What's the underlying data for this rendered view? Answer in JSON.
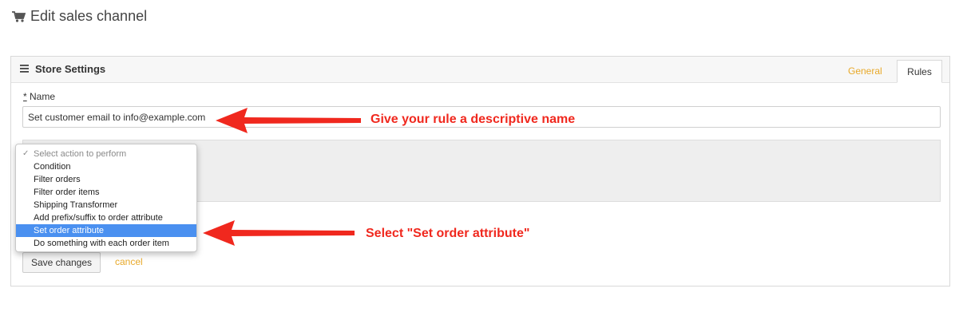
{
  "header": {
    "title": "Edit sales channel",
    "icon": "cart-icon"
  },
  "panel": {
    "title": "Store Settings",
    "tabs": [
      {
        "label": "General",
        "active": false
      },
      {
        "label": "Rules",
        "active": true
      }
    ]
  },
  "form": {
    "name_required_mark": "*",
    "name_label": "Name",
    "name_value": "Set customer email to info@example.com",
    "save_label": "Save changes",
    "cancel_label": "cancel"
  },
  "action_dropdown": {
    "items": [
      "Select action to perform",
      "Condition",
      "Filter orders",
      "Filter order items",
      "Shipping Transformer",
      "Add prefix/suffix to order attribute",
      "Set order attribute",
      "Do something with each order item"
    ],
    "checked_item": "Select action to perform",
    "highlighted_item": "Set order attribute"
  },
  "annotations": {
    "name_hint": "Give your rule a descriptive name",
    "select_hint": "Select \"Set order attribute\""
  },
  "colors": {
    "accent": "#e8a92a",
    "highlight": "#4a90f0",
    "annotation": "#f0281e"
  }
}
